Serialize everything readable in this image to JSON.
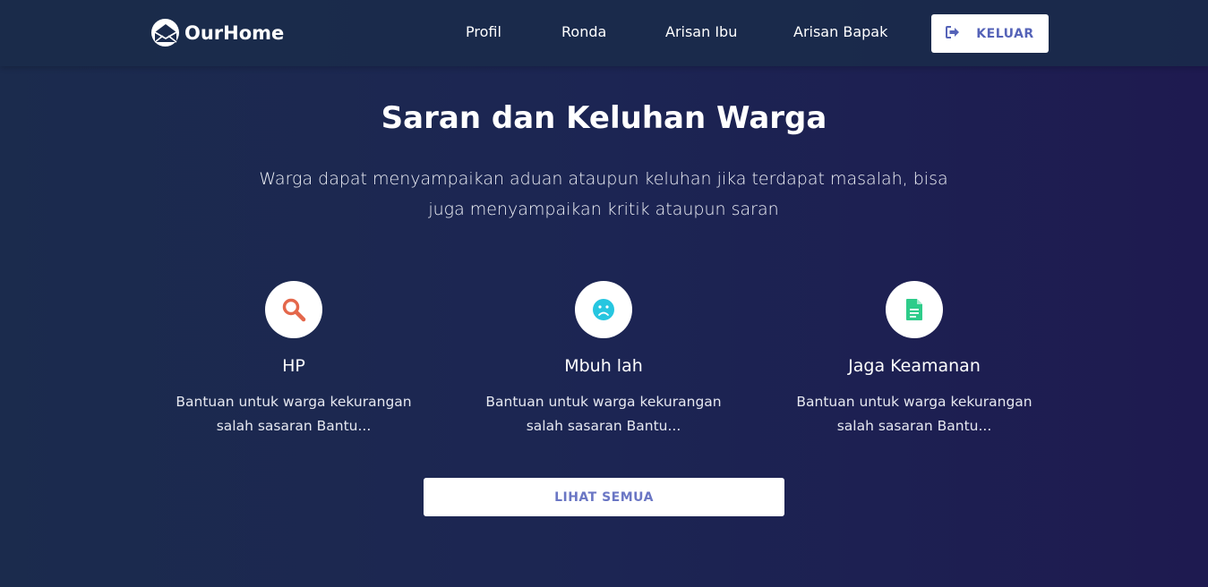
{
  "navbar": {
    "brand": "OurHome",
    "brand_icon": "house-envelope-icon",
    "links": [
      "Profil",
      "Ronda",
      "Arisan Ibu",
      "Arisan Bapak"
    ],
    "logout_label": "KELUAR",
    "logout_icon": "sign-out-icon"
  },
  "hero": {
    "title": "Saran dan Keluhan Warga",
    "subtitle": "Warga dapat menyampaikan aduan ataupun keluhan jika terdapat masalah, bisa juga menyampaikan kritik ataupun saran"
  },
  "cards": [
    {
      "title": "HP",
      "description": "Bantuan untuk warga kekurangan salah sasaran Bantu...",
      "icon": "search-icon",
      "icon_color": "#e4674b"
    },
    {
      "title": "Mbuh lah",
      "description": "Bantuan untuk warga kekurangan salah sasaran Bantu...",
      "icon": "sad-face-icon",
      "icon_color": "#26c6e0"
    },
    {
      "title": "Jaga Keamanan",
      "description": "Bantuan untuk warga kekurangan salah sasaran Bantu...",
      "icon": "document-icon",
      "icon_color": "#2ecc8a"
    }
  ],
  "see_all_label": "LIHAT SEMUA",
  "colors": {
    "background_start": "#1b2b4d",
    "background_end": "#1e1a50",
    "button_text": "#5563b8"
  }
}
